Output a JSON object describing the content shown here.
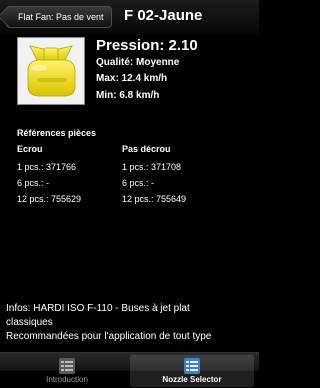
{
  "nav": {
    "back_label": "Flat Fan: Pas de vent",
    "title": "F 02-Jaune"
  },
  "nozzle": {
    "image_icon": "yellow-nozzle-icon",
    "color": "#f2e01a",
    "pressure": "Pression: 2.10",
    "quality": "Qualité: Moyenne",
    "max": "Max: 12.4 km/h",
    "min": "Min: 6.8 km/h"
  },
  "references": {
    "title": "Références pièces",
    "columns": [
      "Ecrou",
      "Pas décrou"
    ],
    "rows": [
      [
        "1 pcs.: 371766",
        "1 pcs.: 371708"
      ],
      [
        "6 pcs.: -",
        "6 pcs.: -"
      ],
      [
        "12 pcs.: 755629",
        "12 pcs.: 755649"
      ]
    ]
  },
  "info": {
    "line1": "Infos:  HARDI ISO F-110 - Buses à jet plat",
    "line2": "classiques",
    "line3": "Recommandées pour l'application de tout type"
  },
  "tabs": [
    {
      "label": "Introduction",
      "icon": "list-icon",
      "active": false
    },
    {
      "label": "Nozzle Selector",
      "icon": "list-icon",
      "active": true
    }
  ]
}
